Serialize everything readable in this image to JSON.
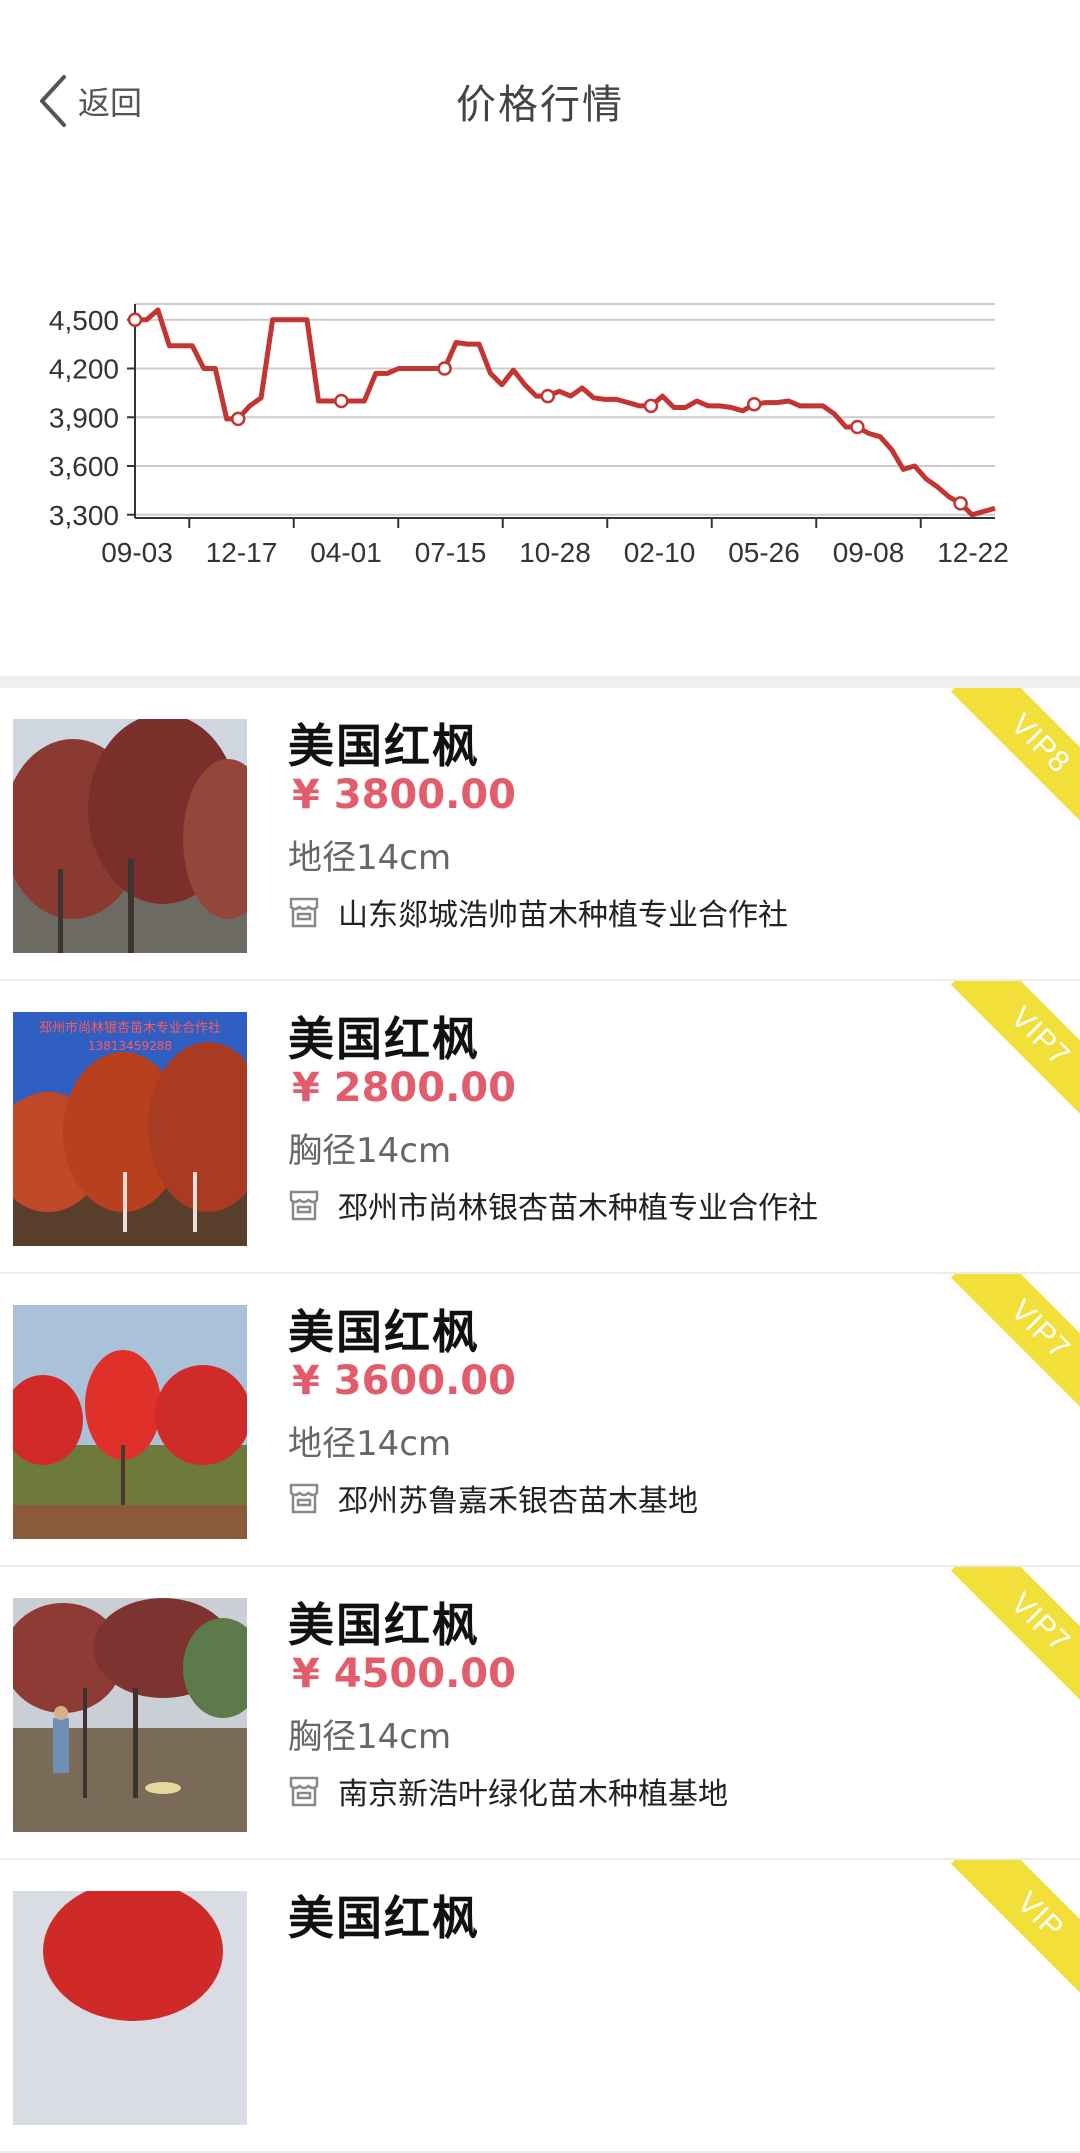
{
  "nav": {
    "back_label": "返回",
    "title": "价格行情"
  },
  "chart_data": {
    "type": "line",
    "yticks": [
      "4,500",
      "4,200",
      "3,900",
      "3,600",
      "3,300"
    ],
    "ytick_values": [
      4500,
      4200,
      3900,
      3600,
      3300
    ],
    "ylim": [
      3280,
      4560
    ],
    "xticks": [
      "09-03",
      "12-17",
      "04-01",
      "07-15",
      "10-28",
      "02-10",
      "05-26",
      "09-08",
      "12-22"
    ],
    "color": "#c23531",
    "series": [
      {
        "values": [
          4500,
          4500,
          4560,
          4340,
          4340,
          4340,
          4200,
          4200,
          3890,
          3890,
          3970,
          4020,
          4500,
          4500,
          4500,
          4500,
          4000,
          4000,
          4000,
          4000,
          4000,
          4170,
          4170,
          4200,
          4200,
          4200,
          4200,
          4200,
          4360,
          4350,
          4350,
          4170,
          4100,
          4190,
          4100,
          4030,
          4030,
          4060,
          4030,
          4080,
          4020,
          4010,
          4010,
          3990,
          3970,
          3970,
          4030,
          3960,
          3960,
          4000,
          3970,
          3970,
          3960,
          3940,
          3980,
          3990,
          3990,
          4000,
          3970,
          3970,
          3970,
          3920,
          3840,
          3840,
          3800,
          3780,
          3700,
          3580,
          3600,
          3520,
          3470,
          3410,
          3370,
          3300,
          3320,
          3340
        ],
        "marked_points": [
          0,
          9,
          18,
          27,
          36,
          45,
          54,
          63,
          72
        ]
      }
    ]
  },
  "products": [
    {
      "name": "美国红枫",
      "price": "¥ 3800.00",
      "spec": "地径14cm",
      "vendor": "山东郯城浩帅苗木种植专业合作社",
      "vip": "VIP8"
    },
    {
      "name": "美国红枫",
      "price": "¥ 2800.00",
      "spec": "胸径14cm",
      "vendor": "邳州市尚林银杏苗木种植专业合作社",
      "vip": "VIP7"
    },
    {
      "name": "美国红枫",
      "price": "¥ 3600.00",
      "spec": "地径14cm",
      "vendor": "邳州苏鲁嘉禾银杏苗木基地",
      "vip": "VIP7"
    },
    {
      "name": "美国红枫",
      "price": "¥ 4500.00",
      "spec": "胸径14cm",
      "vendor": "南京新浩叶绿化苗木种植基地",
      "vip": "VIP7"
    },
    {
      "name": "美国红枫",
      "price": "",
      "spec": "",
      "vendor": "",
      "vip": "VIP"
    }
  ],
  "thumb_watermark": [
    "邳州市尚林银杏苗木专业合作社",
    "13813459288"
  ],
  "colors": {
    "accent_price": "#e25c6b",
    "ribbon": "#f2df3a",
    "line": "#c23531"
  }
}
